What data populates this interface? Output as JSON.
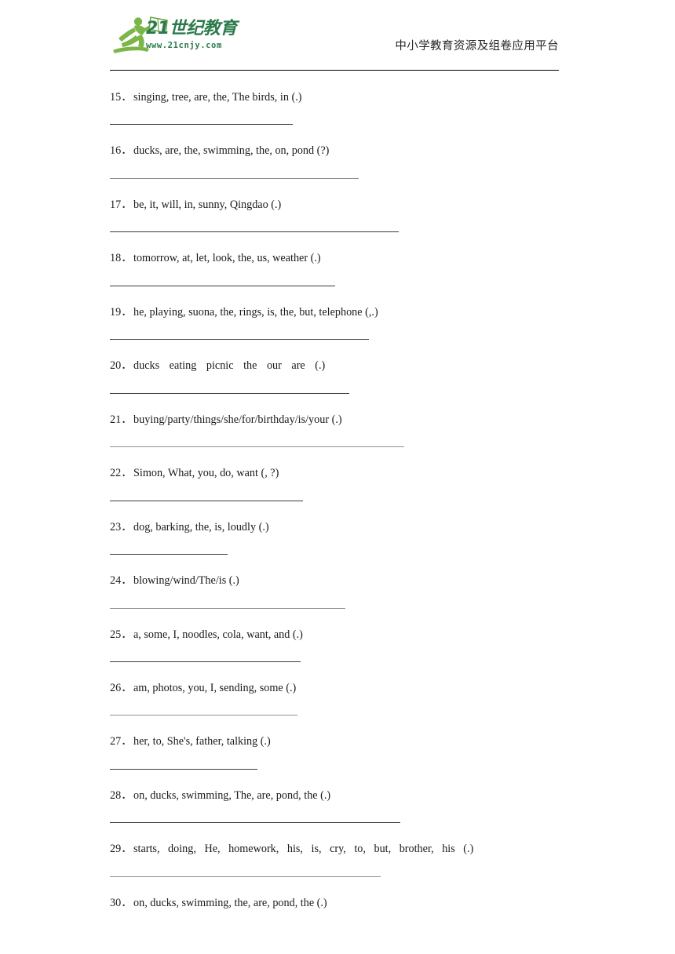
{
  "header": {
    "logo_text": "21世纪教育",
    "logo_url": "www.21cnjy.com",
    "tagline": "中小学教育资源及组卷应用平台",
    "logo_color": "#2b7a4b",
    "logo_light_green": "#7ab648"
  },
  "questions": [
    {
      "num": "15．",
      "text": "singing, tree, are, the, The birds, in (.)",
      "style": "normal",
      "line_width": 233,
      "line_color": "dark"
    },
    {
      "num": "16．",
      "text": "ducks, are, the, swimming, the, on, pond (?)",
      "style": "normal",
      "line_width": 317,
      "line_color": "gray"
    },
    {
      "num": "17．",
      "text": "be, it, will, in, sunny, Qingdao (.)",
      "style": "normal",
      "line_width": 368,
      "line_color": "dark"
    },
    {
      "num": "18．",
      "text": "tomorrow, at, let, look, the, us, weather (.)",
      "style": "normal",
      "line_width": 287,
      "line_color": "dark"
    },
    {
      "num": "19．",
      "text": "he, playing, suona, the, rings, is, the, but, telephone (,.)",
      "style": "normal",
      "line_width": 330,
      "line_color": "dark"
    },
    {
      "num": "20．",
      "text": "ducks   eating   picnic  the   our   are    (.)",
      "style": "spaced",
      "line_width": 305,
      "line_color": "dark"
    },
    {
      "num": "21．",
      "text": "buying/party/things/she/for/birthday/is/your (.)",
      "style": "normal",
      "line_width": 375,
      "line_color": "gray"
    },
    {
      "num": "22．",
      "text": "Simon, What, you, do, want (, ?)",
      "style": "normal",
      "line_width": 246,
      "line_color": "dark"
    },
    {
      "num": "23．",
      "text": "dog, barking, the, is, loudly (.)",
      "style": "normal",
      "line_width": 150,
      "line_color": "dark"
    },
    {
      "num": "24．",
      "text": "blowing/wind/The/is (.)",
      "style": "normal",
      "line_width": 300,
      "line_color": "gray"
    },
    {
      "num": "25．",
      "text": "a, some, I, noodles, cola, want, and (.)",
      "style": "normal",
      "line_width": 243,
      "line_color": "dark"
    },
    {
      "num": "26．",
      "text": "am, photos, you, I, sending, some (.)",
      "style": "normal",
      "line_width": 239,
      "line_color": "gray"
    },
    {
      "num": "27．",
      "text": "her, to, She's, father, talking (.)",
      "style": "normal",
      "line_width": 188,
      "line_color": "dark"
    },
    {
      "num": "28．",
      "text": "on, ducks, swimming, The, are, pond, the (.)",
      "style": "normal",
      "line_width": 370,
      "line_color": "dark"
    },
    {
      "num": "29．",
      "text": "starts,  doing,  He,  homework,  his,  is,  cry,  to,  but,  brother,  his   (.)",
      "style": "spaced-wide",
      "line_width": 345,
      "line_color": "gray"
    },
    {
      "num": "30．",
      "text": "on, ducks, swimming, the, are, pond, the (.)",
      "style": "normal",
      "line_width": 0,
      "line_color": "none"
    }
  ]
}
